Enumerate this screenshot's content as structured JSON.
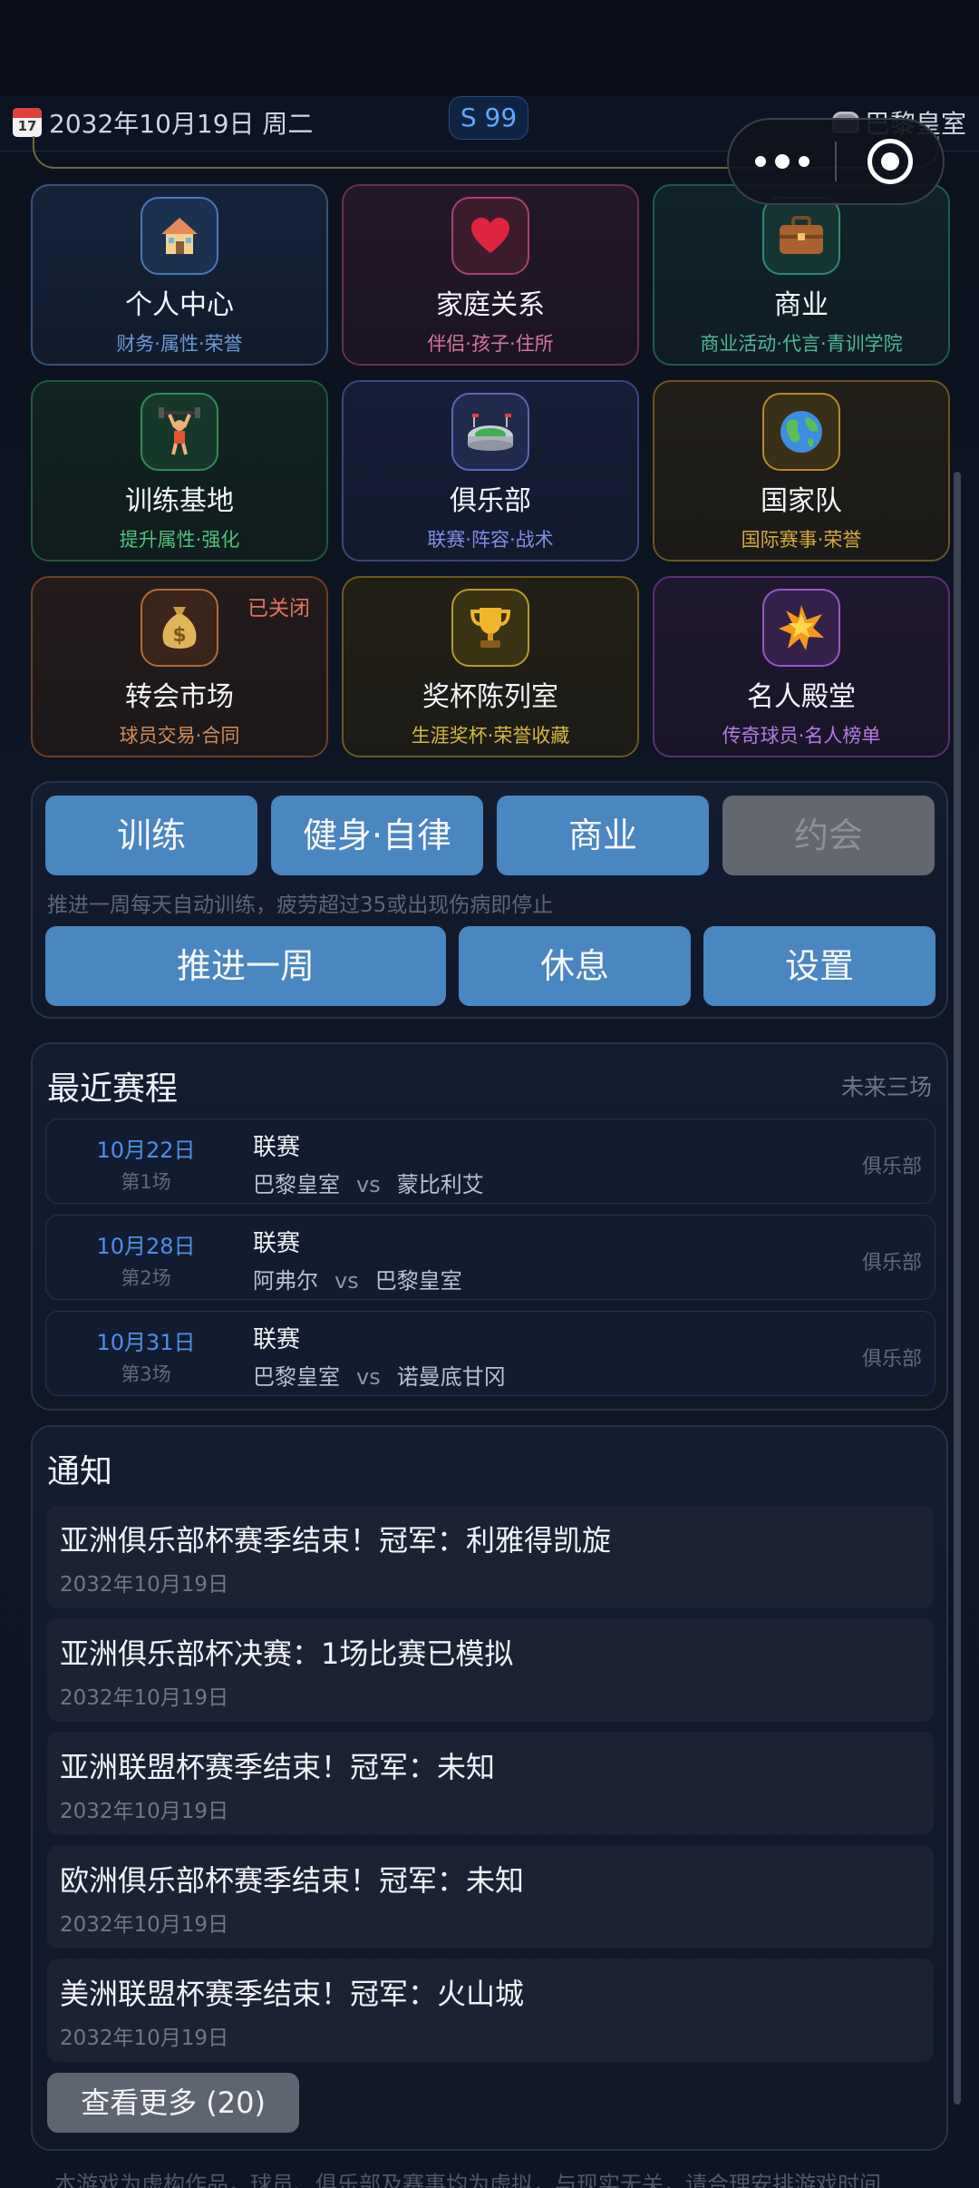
{
  "header": {
    "calendar_icon_day": "17",
    "date": "2032年10月19日 周二",
    "season_badge": "S 99",
    "club_name": "巴黎皇室"
  },
  "features": [
    {
      "title": "个人中心",
      "sub": "财务·属性·荣誉",
      "icon": "house-icon",
      "glyph": "🏠"
    },
    {
      "title": "家庭关系",
      "sub": "伴侣·孩子·住所",
      "icon": "heart-icon",
      "glyph": "❤"
    },
    {
      "title": "商业",
      "sub": "商业活动·代言·青训学院",
      "icon": "briefcase-icon",
      "glyph": "💼"
    },
    {
      "title": "训练基地",
      "sub": "提升属性·强化",
      "icon": "weightlifter-icon",
      "glyph": "🏋"
    },
    {
      "title": "俱乐部",
      "sub": "联赛·阵容·战术",
      "icon": "stadium-icon",
      "glyph": "🏟"
    },
    {
      "title": "国家队",
      "sub": "国际赛事·荣誉",
      "icon": "globe-icon",
      "glyph": "🌍"
    },
    {
      "title": "转会市场",
      "sub": "球员交易·合同",
      "icon": "money-bag-icon",
      "glyph": "💰",
      "badge": "已关闭"
    },
    {
      "title": "奖杯陈列室",
      "sub": "生涯奖杯·荣誉收藏",
      "icon": "trophy-icon",
      "glyph": "🏆"
    },
    {
      "title": "名人殿堂",
      "sub": "传奇球员·名人榜单",
      "icon": "star-burst-icon",
      "glyph": "🌟"
    }
  ],
  "actions": {
    "train": "训练",
    "fitness": "健身·自律",
    "business": "商业",
    "dating": "约会",
    "hint": "推进一周每天自动训练，疲劳超过35或出现伤病即停止",
    "advance_week": "推进一周",
    "rest": "休息",
    "settings": "设置"
  },
  "schedule": {
    "title": "最近赛程",
    "note": "未来三场",
    "matches": [
      {
        "date": "10月22日",
        "round": "第1场",
        "competition": "联赛",
        "home": "巴黎皇室",
        "vs": "vs",
        "away": "蒙比利艾",
        "tag": "俱乐部"
      },
      {
        "date": "10月28日",
        "round": "第2场",
        "competition": "联赛",
        "home": "阿弗尔",
        "vs": "vs",
        "away": "巴黎皇室",
        "tag": "俱乐部"
      },
      {
        "date": "10月31日",
        "round": "第3场",
        "competition": "联赛",
        "home": "巴黎皇室",
        "vs": "vs",
        "away": "诺曼底甘冈",
        "tag": "俱乐部"
      }
    ]
  },
  "notices": {
    "title": "通知",
    "items": [
      {
        "text": "亚洲俱乐部杯赛季结束！冠军：利雅得凯旋",
        "date": "2032年10月19日"
      },
      {
        "text": "亚洲俱乐部杯决赛：1场比赛已模拟",
        "date": "2032年10月19日"
      },
      {
        "text": "亚洲联盟杯赛季结束！冠军：未知",
        "date": "2032年10月19日"
      },
      {
        "text": "欧洲俱乐部杯赛季结束！冠军：未知",
        "date": "2032年10月19日"
      },
      {
        "text": "美洲联盟杯赛季结束！冠军：火山城",
        "date": "2032年10月19日"
      }
    ],
    "more_label": "查看更多 (20)"
  },
  "footer": "本游戏为虚构作品，球员、俱乐部及赛事均为虚拟，与现实无关，请合理安排游戏时间"
}
